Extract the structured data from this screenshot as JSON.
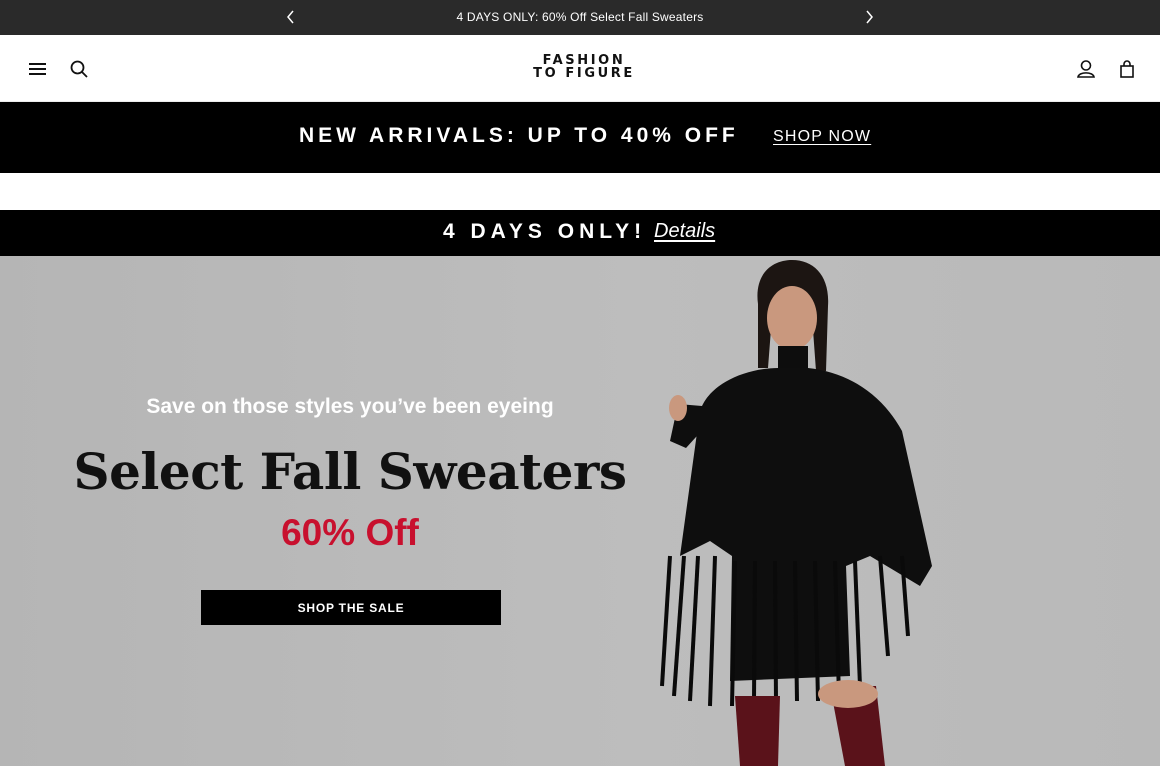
{
  "announcement": {
    "message": "4 DAYS ONLY: 60% Off Select Fall Sweaters",
    "prev_icon": "chevron-left-icon",
    "next_icon": "chevron-right-icon"
  },
  "header": {
    "logo_line1": "FASHION",
    "logo_line2": "TO FIGURE",
    "left_icons": [
      "hamburger-menu-icon",
      "search-icon"
    ],
    "right_icons": [
      "user-icon",
      "shopping-bag-icon"
    ]
  },
  "promo": {
    "text": "NEW ARRIVALS: UP TO 40% OFF",
    "link": "SHOP NOW"
  },
  "days_banner": {
    "text": "4 DAYS ONLY!",
    "link": "Details"
  },
  "hero": {
    "subtitle": "Save on those styles you’ve been eyeing",
    "title": "Select Fall Sweaters",
    "discount": "60% Off",
    "cta": "SHOP THE SALE",
    "discount_color": "#c8102e",
    "background_color": "#bababa"
  }
}
